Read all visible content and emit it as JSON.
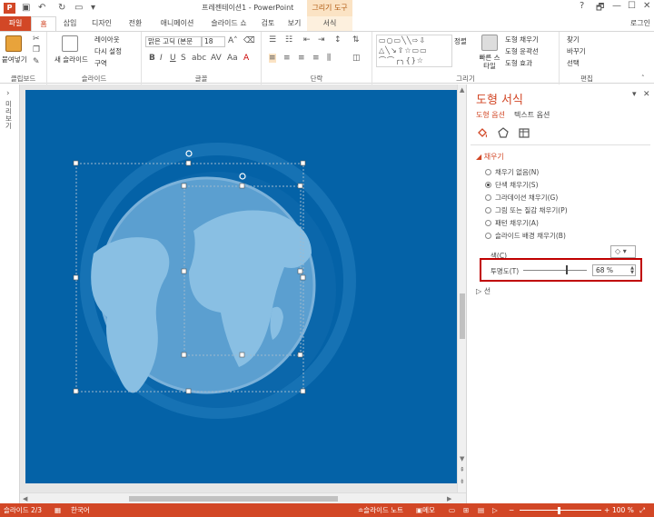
{
  "window": {
    "title": "프레젠테이션1 - PowerPoint",
    "contextual_group": "그리기 도구",
    "login": "로그인",
    "controls": [
      "?",
      "🗗",
      "—",
      "☐",
      "✕"
    ]
  },
  "tabs": [
    "파일",
    "홈",
    "삽입",
    "디자인",
    "전환",
    "애니메이션",
    "슬라이드 쇼",
    "검토",
    "보기",
    "서식"
  ],
  "ribbon": {
    "clipboard": {
      "paste": "붙여넣기",
      "label": "클립보드"
    },
    "slides": {
      "new_slide": "새 슬라이드",
      "layout": "레이아웃",
      "reset": "다시 설정",
      "section": "구역",
      "label": "슬라이드"
    },
    "font": {
      "name": "맑은 고딕 (본문",
      "size": "18",
      "label": "글꼴"
    },
    "paragraph": {
      "label": "단락"
    },
    "drawing": {
      "arrange": "정렬",
      "quick_styles": "빠른 스타일",
      "fill": "도형 채우기",
      "outline": "도형 윤곽선",
      "effects": "도형 효과",
      "label": "그리기"
    },
    "editing": {
      "find": "찾기",
      "replace": "바꾸기",
      "select": "선택",
      "label": "편집"
    }
  },
  "leftstrip": {
    "label": "미리보기"
  },
  "pane": {
    "title": "도형 서식",
    "tab_shape": "도형 옵션",
    "tab_text": "텍스트 옵션",
    "fill_section": "채우기",
    "fill_options": [
      {
        "label": "채우기 없음(N)",
        "selected": false
      },
      {
        "label": "단색 채우기(S)",
        "selected": true
      },
      {
        "label": "그라데이션 채우기(G)",
        "selected": false
      },
      {
        "label": "그림 또는 질감 채우기(P)",
        "selected": false
      },
      {
        "label": "패턴 채우기(A)",
        "selected": false
      },
      {
        "label": "슬라이드 배경 채우기(B)",
        "selected": false
      }
    ],
    "color_label": "색(C)",
    "transparency_label": "투명도(T)",
    "transparency_value": "68 %",
    "transparency_fraction": 0.68,
    "line_section": "선"
  },
  "status": {
    "slide_info": "슬라이드 2/3",
    "language": "한국어",
    "notes": "슬라이드 노트",
    "comments": "메모",
    "zoom": "100 %"
  },
  "colors": {
    "accent": "#d24726",
    "slide_bg": "#0462a7",
    "highlight": "#c00000"
  }
}
